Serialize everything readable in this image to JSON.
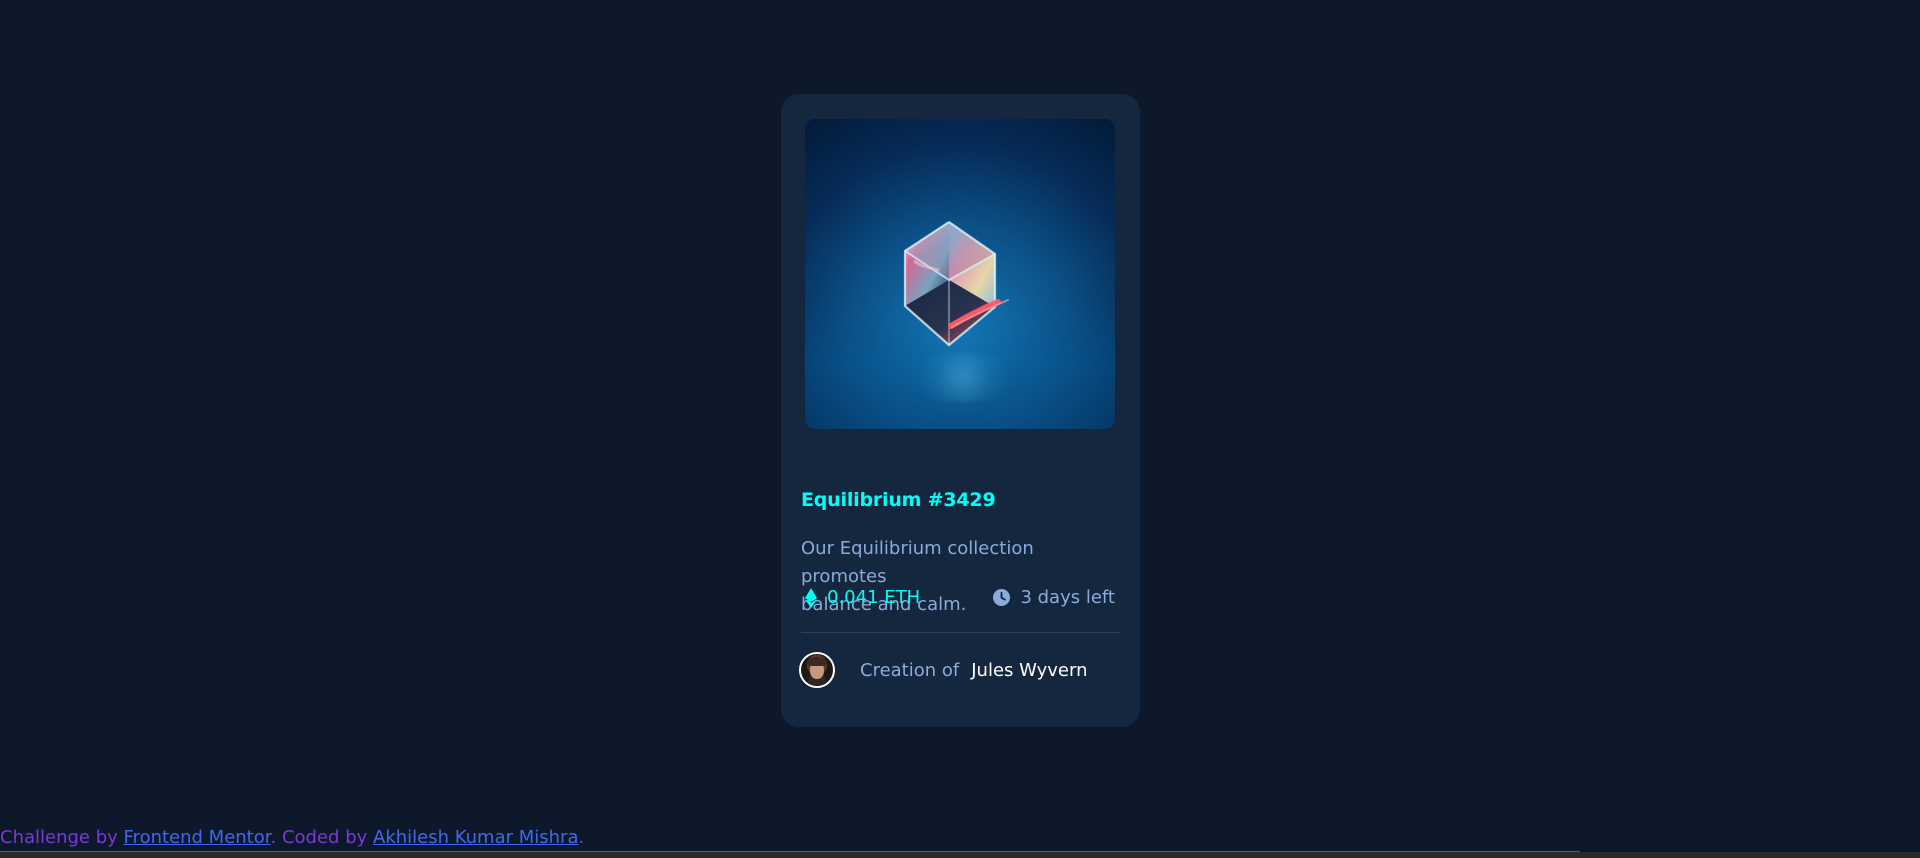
{
  "nft_card": {
    "title": "Equilibrium #3429",
    "description": "Our Equilibrium collection promotes\nbalance and calm.",
    "price": "0.041 ETH",
    "time_left": "3 days left",
    "creation_prefix": "Creation of",
    "creator_name": "Jules Wyvern",
    "icons": {
      "ethereum": "ethereum-icon",
      "clock": "clock-icon",
      "avatar": "avatar"
    },
    "colors": {
      "page_background": "#0d192b",
      "card_background": "#15263f",
      "accent": "#00fff8",
      "muted_text": "#8bacd9",
      "white_text": "#ffffff",
      "divider": "#2e405a"
    }
  },
  "footer": {
    "prefix": "Challenge by ",
    "frontend_link": "Frontend Mentor",
    "middle": ". Coded by ",
    "author_link": "Akhilesh Kumar Mishra",
    "suffix": ".",
    "colors": {
      "text": "#7b37d7",
      "link": "#3f68f2"
    }
  }
}
